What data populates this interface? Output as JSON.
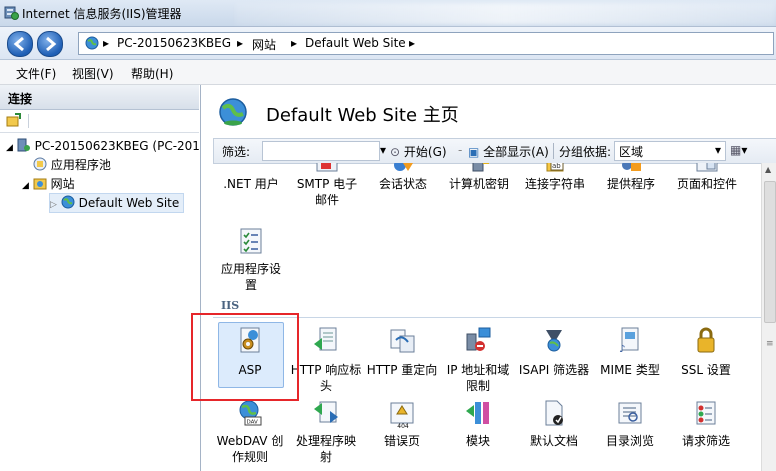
{
  "window": {
    "title": "Internet 信息服务(IIS)管理器"
  },
  "address": {
    "segments": [
      "PC-20150623KBEG",
      "网站",
      "Default Web Site"
    ]
  },
  "menu": [
    "文件(F)",
    "视图(V)",
    "帮助(H)"
  ],
  "connections": {
    "header": "连接",
    "tree": [
      {
        "label": "PC-20150623KBEG (PC-201",
        "level": 0
      },
      {
        "label": "应用程序池",
        "level": 1
      },
      {
        "label": "网站",
        "level": 1
      },
      {
        "label": "Default Web Site",
        "level": 2,
        "selected": true
      }
    ]
  },
  "main": {
    "title": "Default Web Site 主页",
    "filter": {
      "label": "筛选:",
      "start": "开始(G)",
      "show_all": "全部显示(A)",
      "group_by": "分组依据:",
      "group_value": "区域"
    },
    "aspnet_row": [
      ".NET 用户",
      "SMTP 电子\n邮件",
      "会话状态",
      "计算机密钥",
      "连接字符串",
      "提供程序",
      "页面和控件"
    ],
    "app_settings": "应用程序设\n置",
    "iis_group": "IIS",
    "iis_row1": [
      "ASP",
      "HTTP 响应标\n头",
      "HTTP 重定向",
      "IP 地址和域\n限制",
      "ISAPI 筛选器",
      "MIME 类型",
      "SSL 设置"
    ],
    "iis_row2": [
      "WebDAV 创\n作规则",
      "处理程序映\n射",
      "错误页",
      "模块",
      "默认文档",
      "目录浏览",
      "请求筛选"
    ],
    "icons_row2_badge": "404"
  },
  "colors": {
    "accent": "#1f5fb5",
    "highlight_box": "#e6262a",
    "selection": "#dcebfc"
  }
}
